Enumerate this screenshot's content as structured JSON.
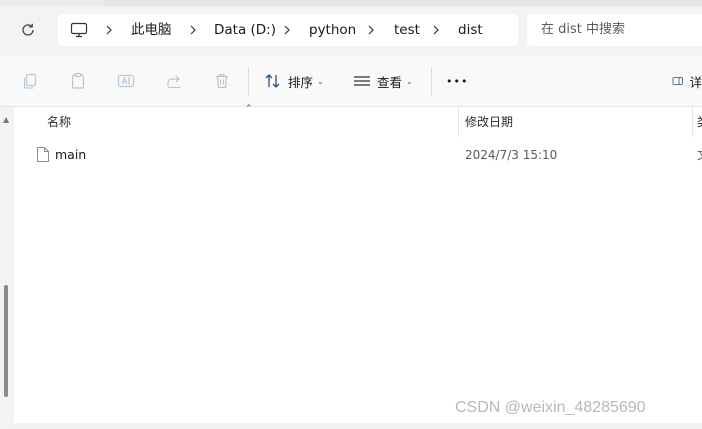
{
  "address": {
    "breadcrumbs": [
      {
        "label": "此电脑"
      },
      {
        "label": "Data (D:)"
      },
      {
        "label": "python"
      },
      {
        "label": "test"
      },
      {
        "label": "dist"
      }
    ],
    "search_placeholder": "在 dist 中搜索"
  },
  "toolbar": {
    "sort_label": "排序",
    "view_label": "查看",
    "more_label": "•••",
    "details_label_cut": "详"
  },
  "columns": {
    "name": "名称",
    "date": "修改日期",
    "type_cut": "类"
  },
  "files": [
    {
      "name": "main",
      "modified": "2024/7/3 15:10",
      "type_cut": "文"
    }
  ],
  "watermark": "CSDN @weixin_48285690"
}
